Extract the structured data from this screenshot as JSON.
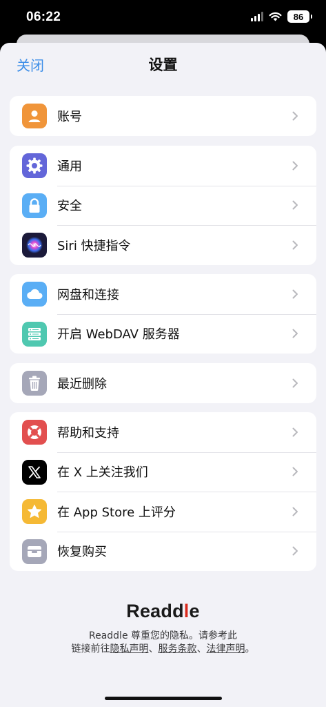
{
  "status_bar": {
    "time": "06:22",
    "battery": "86"
  },
  "nav": {
    "close_label": "关闭",
    "title": "设置"
  },
  "groups": [
    {
      "items": [
        {
          "label": "账号",
          "icon": "person-icon",
          "color": "#f0953a"
        }
      ]
    },
    {
      "items": [
        {
          "label": "通用",
          "icon": "gear-icon",
          "color": "#6366d9"
        },
        {
          "label": "安全",
          "icon": "lock-icon",
          "color": "#5aaef5"
        },
        {
          "label": "Siri 快捷指令",
          "icon": "siri-icon",
          "color": "#1b1a3a"
        }
      ]
    },
    {
      "items": [
        {
          "label": "网盘和连接",
          "icon": "cloud-icon",
          "color": "#5aaef5"
        },
        {
          "label": "开启 WebDAV 服务器",
          "icon": "server-icon",
          "color": "#4fc8b0"
        }
      ]
    },
    {
      "items": [
        {
          "label": "最近删除",
          "icon": "trash-icon",
          "color": "#a5a7b8"
        }
      ]
    },
    {
      "items": [
        {
          "label": "帮助和支持",
          "icon": "lifebuoy-icon",
          "color": "#e24f4f"
        },
        {
          "label": "在 X 上关注我们",
          "icon": "x-logo-icon",
          "color": "#000000"
        },
        {
          "label": "在 App Store 上评分",
          "icon": "star-icon",
          "color": "#f5b935"
        },
        {
          "label": "恢复购买",
          "icon": "restore-icon",
          "color": "#a5a7b8"
        }
      ]
    }
  ],
  "footer": {
    "logo_main": "Readd",
    "logo_accent": "l",
    "logo_end": "e",
    "line1": "Readdle 尊重您的隐私。请参考此",
    "line2_prefix": "链接前往",
    "privacy_link": "隐私声明",
    "sep1": "、",
    "terms_link": "服务条款",
    "sep2": "、",
    "legal_link": "法律声明",
    "end": "。"
  }
}
